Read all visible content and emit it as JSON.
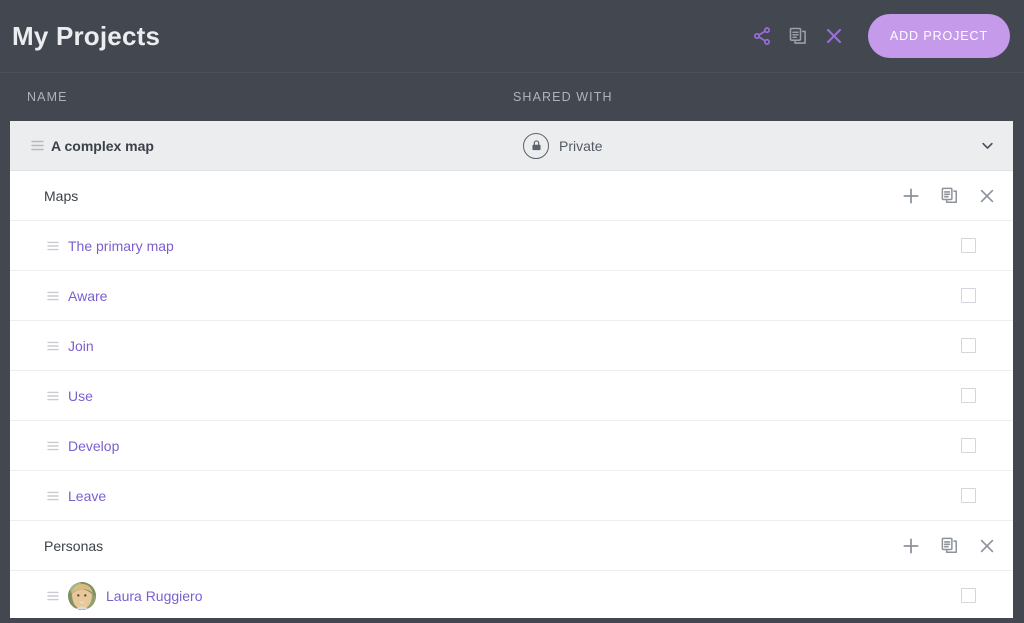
{
  "header": {
    "title": "My Projects",
    "actions": [
      {
        "icon": "share-icon",
        "name": "share-button",
        "color": "#9b6ddc"
      },
      {
        "icon": "duplicate-icon",
        "name": "duplicate-button",
        "color": "#9aa0a8"
      },
      {
        "icon": "close-icon",
        "name": "close-button",
        "color": "#9b6ddc"
      }
    ],
    "add_project_label": "ADD PROJECT",
    "add_project_color": "#c59aea"
  },
  "columns": {
    "name": "NAME",
    "shared_with": "SHARED WITH"
  },
  "project": {
    "name": "A complex map",
    "shared_with": "Private",
    "shared_icon": "lock-icon",
    "expanded": true,
    "chevron": "chevron-down-icon",
    "drag_handle": "drag-handle-icon"
  },
  "sections": [
    {
      "title": "Maps",
      "actions": [
        {
          "icon": "plus-icon",
          "name": "add-map-button"
        },
        {
          "icon": "duplicate-icon",
          "name": "duplicate-maps-button"
        },
        {
          "icon": "close-icon",
          "name": "delete-maps-button"
        }
      ],
      "items": [
        {
          "label": "The primary map",
          "checked": false,
          "avatar": false
        },
        {
          "label": "Aware",
          "checked": false,
          "avatar": false
        },
        {
          "label": "Join",
          "checked": false,
          "avatar": false
        },
        {
          "label": "Use",
          "checked": false,
          "avatar": false
        },
        {
          "label": "Develop",
          "checked": false,
          "avatar": false
        },
        {
          "label": "Leave",
          "checked": false,
          "avatar": false
        }
      ]
    },
    {
      "title": "Personas",
      "actions": [
        {
          "icon": "plus-icon",
          "name": "add-persona-button"
        },
        {
          "icon": "duplicate-icon",
          "name": "duplicate-personas-button"
        },
        {
          "icon": "close-icon",
          "name": "delete-personas-button"
        }
      ],
      "items": [
        {
          "label": "Laura Ruggiero",
          "checked": false,
          "avatar": true
        }
      ]
    }
  ],
  "theme": {
    "shell_bg": "#424750",
    "panel_bg": "#ffffff",
    "project_row_bg": "#ebedef",
    "link_purple": "#7b5fd0",
    "accent_purple": "#9b6ddc",
    "muted_gray": "#9aa0a8"
  }
}
